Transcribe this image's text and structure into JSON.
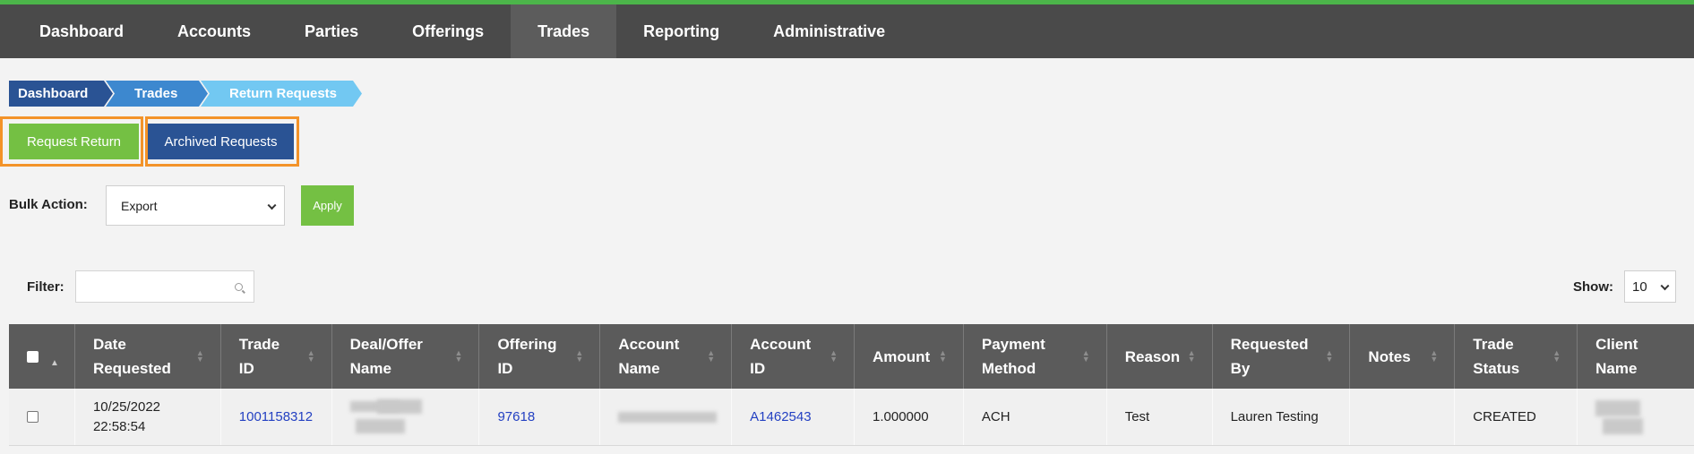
{
  "nav": {
    "items": [
      {
        "label": "Dashboard"
      },
      {
        "label": "Accounts"
      },
      {
        "label": "Parties"
      },
      {
        "label": "Offerings"
      },
      {
        "label": "Trades"
      },
      {
        "label": "Reporting"
      },
      {
        "label": "Administrative"
      }
    ],
    "active": "Trades"
  },
  "breadcrumb": [
    "Dashboard",
    "Trades",
    "Return Requests"
  ],
  "actions": {
    "request_return": "Request Return",
    "archived_requests": "Archived Requests"
  },
  "bulk": {
    "label": "Bulk Action:",
    "selected": "Export",
    "apply": "Apply"
  },
  "filter": {
    "label": "Filter:",
    "value": "",
    "show_label": "Show:",
    "show_value": "10"
  },
  "table": {
    "columns": [
      {
        "l1": "Date",
        "l2": "Requested"
      },
      {
        "l1": "Trade",
        "l2": "ID"
      },
      {
        "l1": "Deal/Offer",
        "l2": "Name"
      },
      {
        "l1": "Offering",
        "l2": "ID"
      },
      {
        "l1": "Account",
        "l2": "Name"
      },
      {
        "l1": "Account",
        "l2": "ID"
      },
      {
        "l1": "Amount",
        "l2": ""
      },
      {
        "l1": "Payment",
        "l2": "Method"
      },
      {
        "l1": "Reason",
        "l2": ""
      },
      {
        "l1": "Requested",
        "l2": "By"
      },
      {
        "l1": "Notes",
        "l2": ""
      },
      {
        "l1": "Trade",
        "l2": "Status"
      },
      {
        "l1": "Client",
        "l2": "Name"
      }
    ],
    "rows": [
      {
        "date_l1": "10/25/2022",
        "date_l2": "22:58:54",
        "trade_id": "1001158312",
        "offering_id": "97618",
        "account_id": "A1462543",
        "amount": "1.000000",
        "payment_method": "ACH",
        "reason": "Test",
        "requested_by": "Lauren Testing",
        "notes": "",
        "trade_status": "CREATED"
      }
    ]
  },
  "colors": {
    "nav_bg": "#4a4a4a",
    "accent_green": "#74c043",
    "primary_blue": "#2a5394",
    "highlight_orange": "#f39329",
    "link_blue": "#2340c2"
  }
}
